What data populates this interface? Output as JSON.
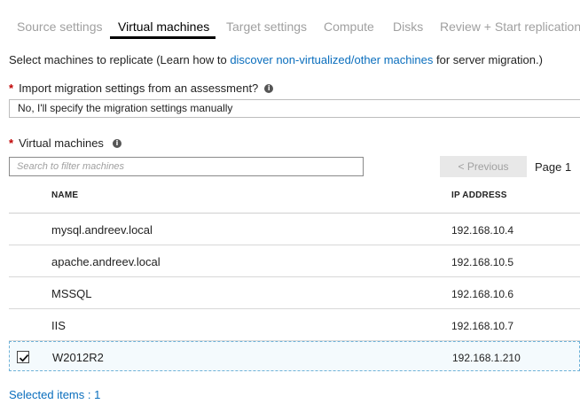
{
  "tabs": [
    {
      "label": "Source settings",
      "active": false
    },
    {
      "label": "Virtual machines",
      "active": true
    },
    {
      "label": "Target settings",
      "active": false
    },
    {
      "label": "Compute",
      "active": false
    },
    {
      "label": "Disks",
      "active": false
    },
    {
      "label": "Review + Start replication",
      "active": false
    }
  ],
  "intro": {
    "prefix": "Select machines to replicate (Learn how to ",
    "link": "discover non-virtualized/other machines",
    "suffix": " for server migration.)"
  },
  "assessment": {
    "required_mark": "*",
    "label": "Import migration settings from an assessment?",
    "info_icon": "info-icon",
    "value": "No, I'll specify the migration settings manually"
  },
  "vms": {
    "required_mark": "*",
    "label": "Virtual machines",
    "info_icon": "info-icon",
    "search_placeholder": "Search to filter machines",
    "prev_label": "< Previous",
    "page_label": "Page 1"
  },
  "table": {
    "columns": {
      "name": "NAME",
      "ip": "IP ADDRESS"
    },
    "rows": [
      {
        "name": "mysql.andreev.local",
        "ip": "192.168.10.4",
        "selected": false
      },
      {
        "name": "apache.andreev.local",
        "ip": "192.168.10.5",
        "selected": false
      },
      {
        "name": "MSSQL",
        "ip": "192.168.10.6",
        "selected": false
      },
      {
        "name": "IIS",
        "ip": "192.168.10.7",
        "selected": false
      },
      {
        "name": "W2012R2",
        "ip": "192.168.1.210",
        "selected": true
      }
    ]
  },
  "footer": {
    "selected_text": "Selected items : 1"
  },
  "colors": {
    "accent": "#0a6ebd",
    "required": "#c00000",
    "selected_border": "#6fb2d8"
  }
}
